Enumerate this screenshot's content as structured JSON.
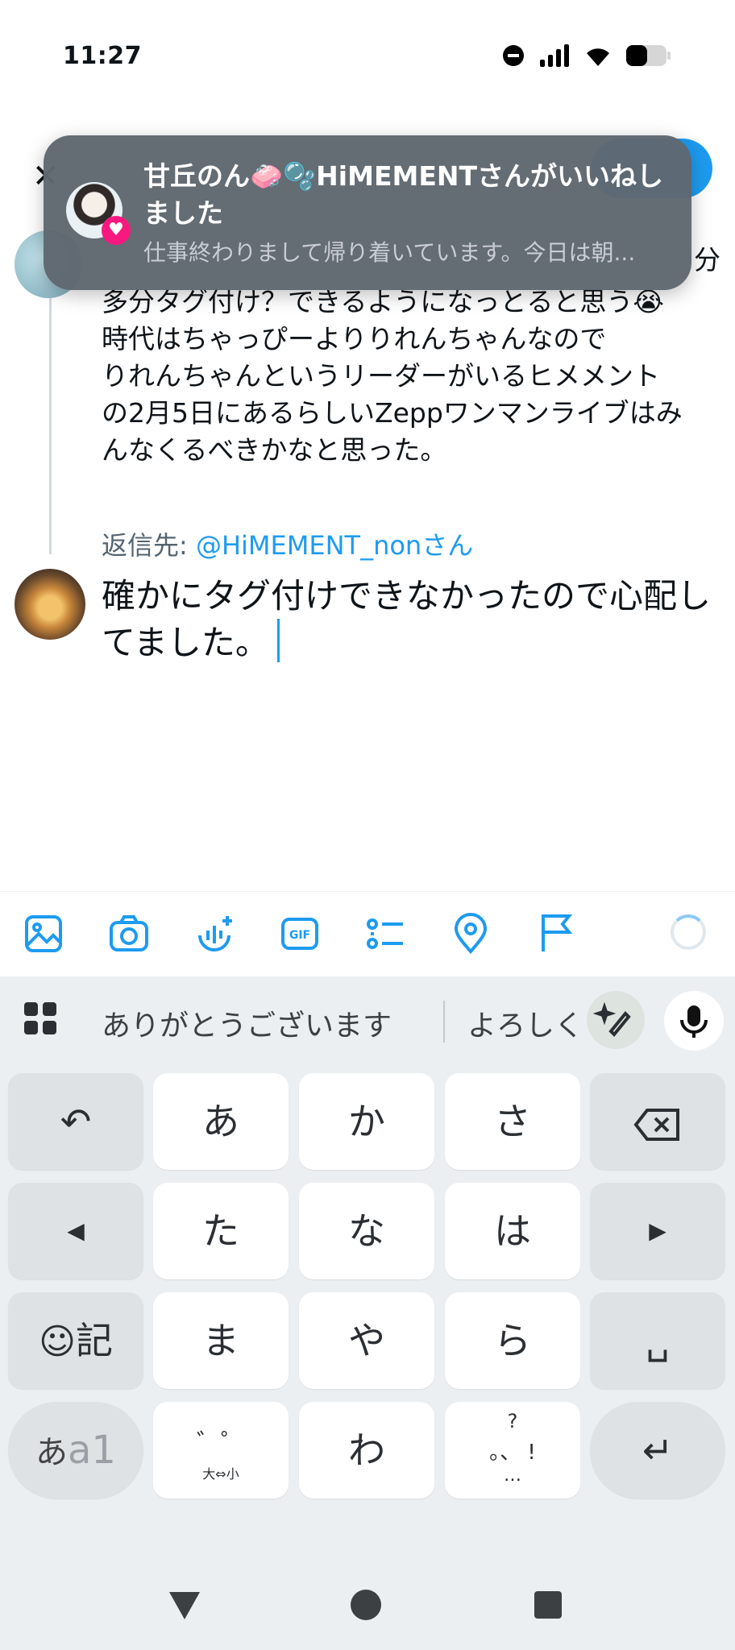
{
  "status_bar": {
    "time": "11:27"
  },
  "thread": {
    "original_tail": "分",
    "original_text": "多分タグ付け？できるようになっとると思う😭\n時代はちゃっぴーよりりれんちゃんなので\nりれんちゃんというリーダーがいるヒメメント\nの2月5日にあるらしいZeppワンマンライブはみ\nんなくるべきかなと思った。",
    "reply_to_label": "返信先: ",
    "reply_to_handle": "@HiMEMENT_nonさん",
    "compose_text": "確かにタグ付けできなかったので心配し\nてました。"
  },
  "toast": {
    "title": "甘丘のん🧼🫧HiMEMENTさんがいいねしました",
    "body": "仕事終わりまして帰り着いています。今日は朝..."
  },
  "toolbar": {
    "icons": [
      "image-icon",
      "camera-icon",
      "audio-space-icon",
      "gif-icon",
      "poll-icon",
      "location-icon",
      "flag-icon"
    ],
    "gif_label": "GIF"
  },
  "keyboard": {
    "suggestions": [
      "ありがとうございます",
      "よろしく"
    ],
    "keys": {
      "undo": "↶",
      "a": "あ",
      "ka": "か",
      "sa": "さ",
      "left": "◀",
      "ta": "た",
      "na": "な",
      "ha": "は",
      "right": "▶",
      "emoji": "記",
      "ma": "ま",
      "ya": "や",
      "ra": "ら",
      "space": "␣",
      "mode_main": "あ",
      "mode_sub": "a1",
      "dakuten_top": "゛゜",
      "dakuten_bottom": "大⇔小",
      "wa": "わ",
      "punct_top": "?",
      "punct_mid": "。、 !",
      "punct_bottom": "…",
      "enter": "↵"
    }
  },
  "colors": {
    "accent": "#1d9bf0",
    "like": "#f91880",
    "toast_bg": "#5f6770"
  }
}
